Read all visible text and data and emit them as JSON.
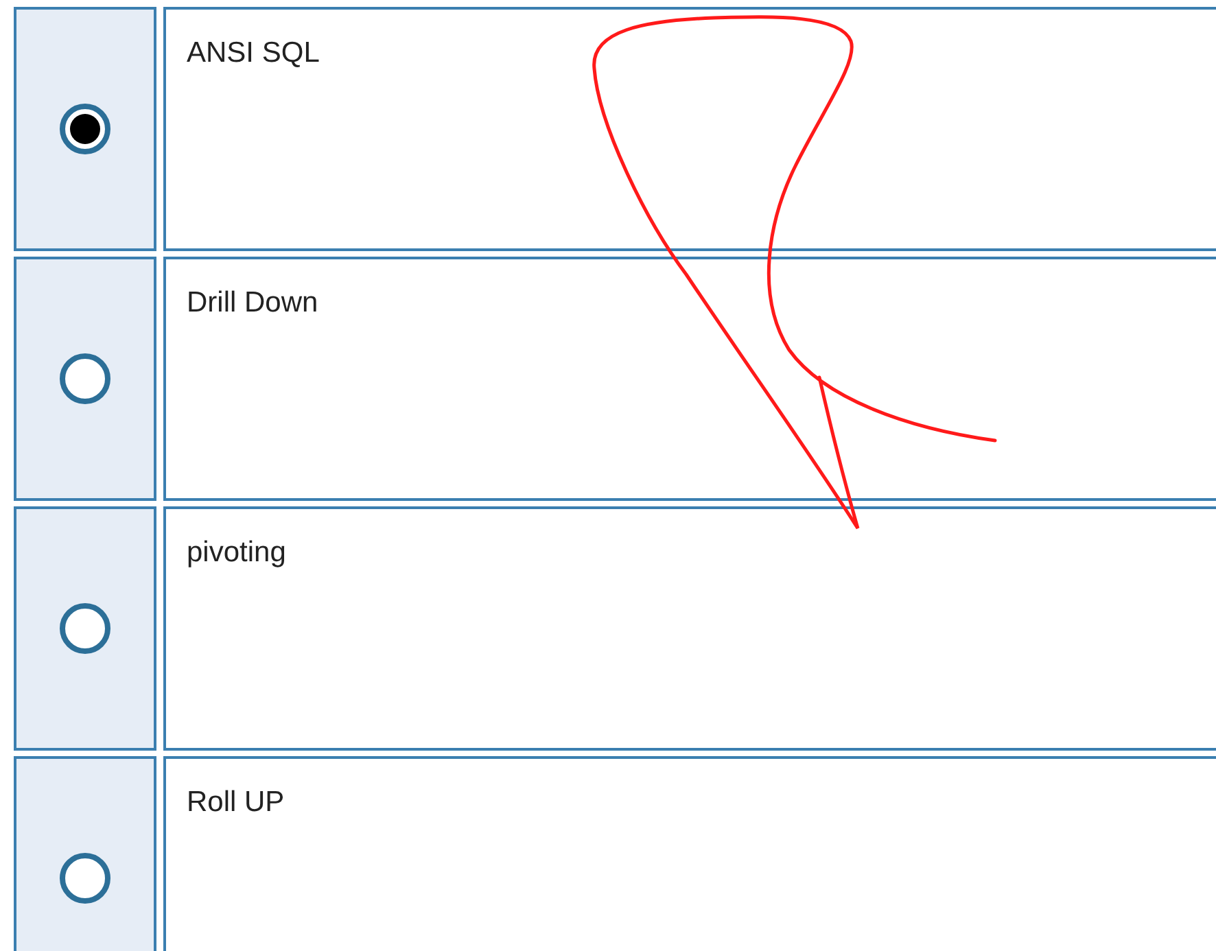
{
  "options": [
    {
      "label": "ANSI SQL",
      "selected": true
    },
    {
      "label": "Drill Down",
      "selected": false
    },
    {
      "label": "pivoting",
      "selected": false
    },
    {
      "label": "Roll UP",
      "selected": false
    }
  ]
}
